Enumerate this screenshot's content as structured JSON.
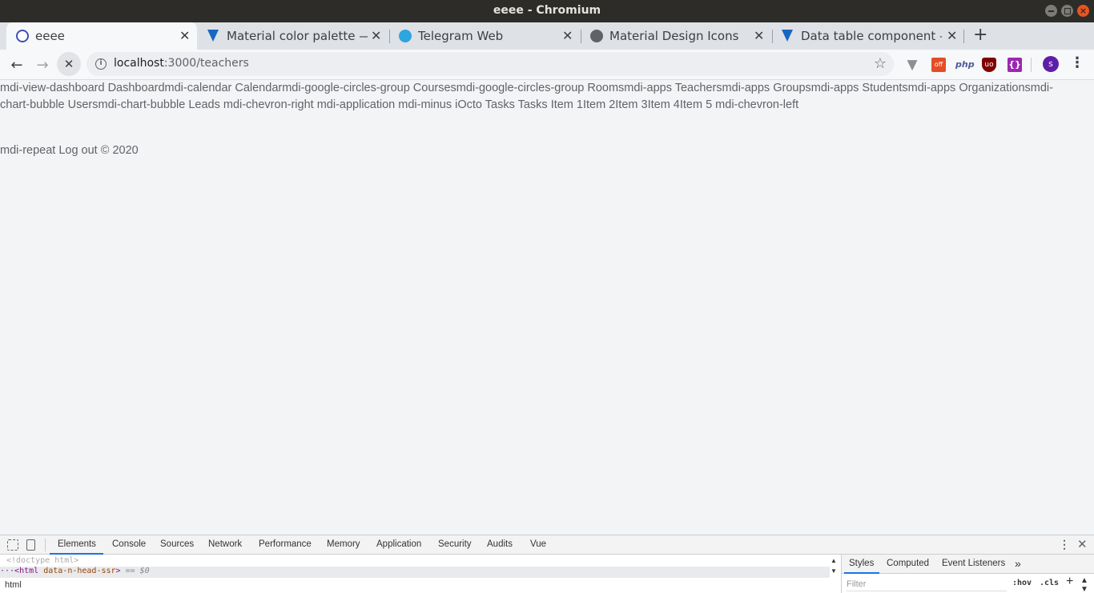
{
  "window": {
    "title": "eeee - Chromium"
  },
  "tabs": [
    {
      "label": "eeee",
      "icon": "nuxt-icon",
      "active": true,
      "color": "#3f51b5"
    },
    {
      "label": "Material color palette — V",
      "icon": "vuetify-icon",
      "color": "#1867c0"
    },
    {
      "label": "Telegram Web",
      "icon": "telegram-icon",
      "color": "#2ca5e0"
    },
    {
      "label": "Material Design Icons",
      "icon": "globe-icon",
      "color": "#5f6368"
    },
    {
      "label": "Data table component — V",
      "icon": "vuetify-icon",
      "color": "#1867c0"
    }
  ],
  "tab_close_glyph": "✕",
  "new_tab_glyph": "+",
  "toolbar": {
    "back_glyph": "←",
    "forward_glyph": "→",
    "stop_glyph": "✕",
    "url_host": "localhost",
    "url_path": ":3000/teachers",
    "star_glyph": "☆",
    "extensions": {
      "vuetify": "▼",
      "off": "off",
      "php": "php",
      "ublock": "uo",
      "braces": "{}"
    },
    "profile_initial": "s",
    "menu_glyph": "⋮"
  },
  "page": {
    "nav_text": "mdi-view-dashboard Dashboardmdi-calendar Calendarmdi-google-circles-group Coursesmdi-google-circles-group Roomsmdi-apps Teachersmdi-apps Groupsmdi-apps Studentsmdi-apps Organizationsmdi-chart-bubble Usersmdi-chart-bubble Leads mdi-chevron-right mdi-application mdi-minus iOcto Tasks Tasks Item 1Item 2Item 3Item 4Item 5 mdi-chevron-left",
    "footer_text": "mdi-repeat Log out © 2020"
  },
  "devtools": {
    "tabs": [
      "Elements",
      "Console",
      "Sources",
      "Network",
      "Performance",
      "Memory",
      "Application",
      "Security",
      "Audits",
      "Vue"
    ],
    "doctype": "<!doctype html>",
    "html_prefix": "···<",
    "html_tag": "html",
    "html_attr": "data-n-head-ssr",
    "html_suffix": ">",
    "html_eq": "== $0",
    "breadcrumb": "html",
    "styles_tabs": [
      "Styles",
      "Computed",
      "Event Listeners"
    ],
    "styles_more": "»",
    "filter_placeholder": "Filter",
    "hov": ":hov",
    "cls": ".cls",
    "plus": "+",
    "more_glyph": "⋮",
    "close_glyph": "✕"
  }
}
